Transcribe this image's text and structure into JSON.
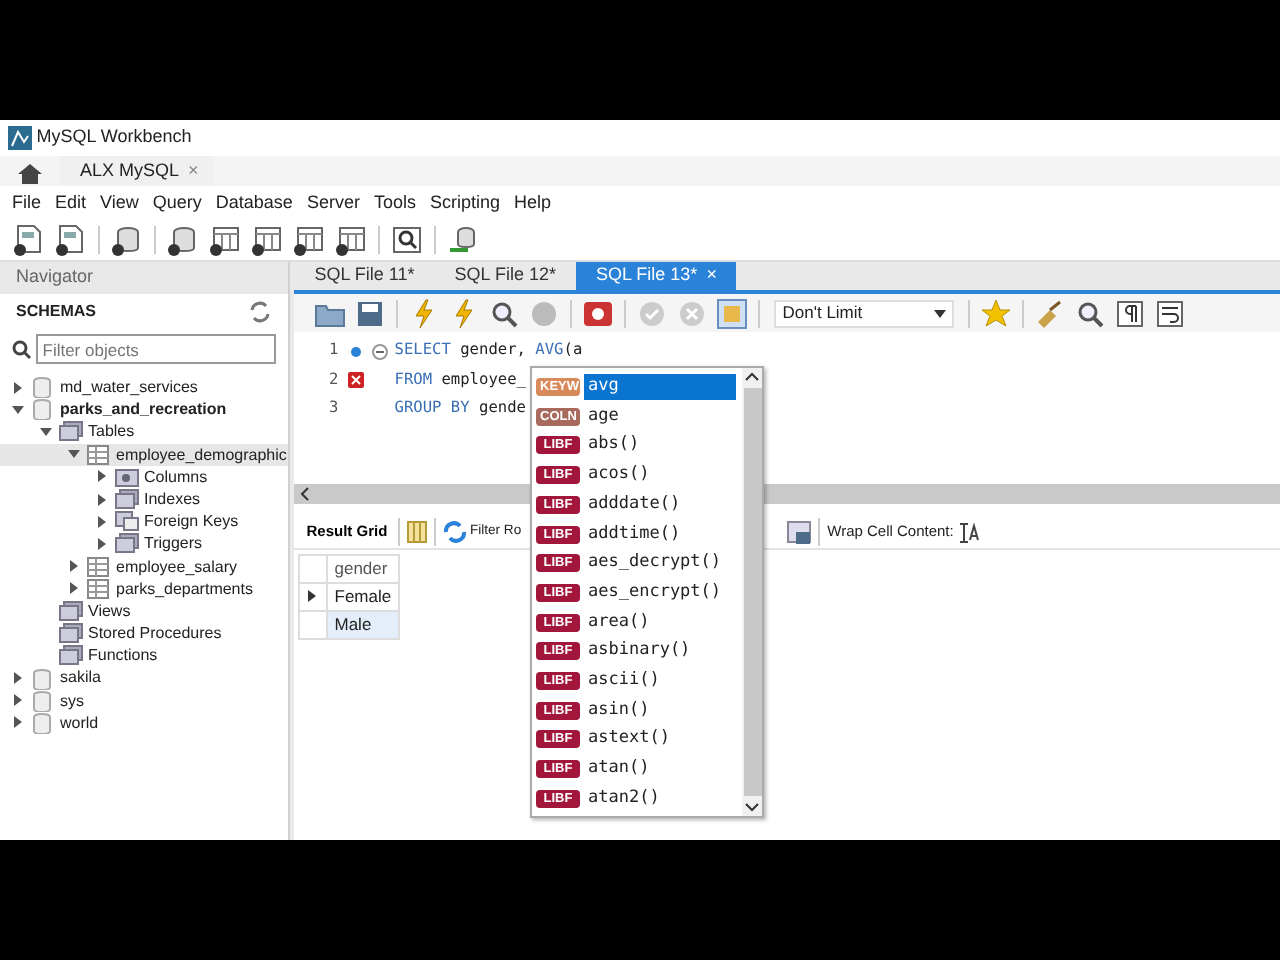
{
  "window": {
    "title": "MySQL Workbench"
  },
  "connection_tabs": [
    {
      "label": "ALX MySQL",
      "close": "×"
    }
  ],
  "menu": [
    "File",
    "Edit",
    "View",
    "Query",
    "Database",
    "Server",
    "Tools",
    "Scripting",
    "Help"
  ],
  "navigator": {
    "title": "Navigator",
    "section": "SCHEMAS",
    "filter": {
      "placeholder": "Filter objects"
    },
    "tree": [
      {
        "label": "md_water_services",
        "kind": "schema",
        "expanded": false,
        "default": false,
        "selected": false
      },
      {
        "label": "parks_and_recreation",
        "kind": "schema",
        "expanded": true,
        "default": true,
        "selected": false,
        "children": [
          {
            "label": "Tables",
            "kind": "folder",
            "expanded": true,
            "default": false,
            "selected": false,
            "children": [
              {
                "label": "employee_demographic",
                "kind": "table",
                "expanded": true,
                "default": false,
                "selected": true,
                "children": [
                  {
                    "label": "Columns",
                    "kind": "columns",
                    "expanded": false,
                    "default": false,
                    "selected": false
                  },
                  {
                    "label": "Indexes",
                    "kind": "folder",
                    "expanded": false,
                    "default": false,
                    "selected": false
                  },
                  {
                    "label": "Foreign Keys",
                    "kind": "keys",
                    "expanded": false,
                    "default": false,
                    "selected": false
                  },
                  {
                    "label": "Triggers",
                    "kind": "folder",
                    "expanded": false,
                    "default": false,
                    "selected": false
                  }
                ]
              },
              {
                "label": "employee_salary",
                "kind": "table",
                "expanded": false,
                "default": false,
                "selected": false
              },
              {
                "label": "parks_departments",
                "kind": "table",
                "expanded": false,
                "default": false,
                "selected": false
              }
            ]
          },
          {
            "label": "Views",
            "kind": "folder",
            "default": false,
            "selected": false
          },
          {
            "label": "Stored Procedures",
            "kind": "folder",
            "default": false,
            "selected": false
          },
          {
            "label": "Functions",
            "kind": "folder",
            "default": false,
            "selected": false
          }
        ]
      },
      {
        "label": "sakila",
        "kind": "schema",
        "expanded": false,
        "default": false,
        "selected": false
      },
      {
        "label": "sys",
        "kind": "schema",
        "expanded": false,
        "default": false,
        "selected": false
      },
      {
        "label": "world",
        "kind": "schema",
        "expanded": false,
        "default": false,
        "selected": false
      }
    ]
  },
  "editor_tabs": [
    {
      "label": "SQL File 11*",
      "selected": false
    },
    {
      "label": "SQL File 12*",
      "selected": false
    },
    {
      "label": "SQL File 13*",
      "selected": true,
      "close": "×"
    }
  ],
  "limit": {
    "value": "Don't Limit"
  },
  "code": [
    {
      "number": "1",
      "current": true,
      "error": false,
      "fold": true,
      "tokens": [
        {
          "text": "SELECT",
          "kind": "keyword"
        },
        {
          "text": " gender, ",
          "kind": "plain"
        },
        {
          "text": "AVG",
          "kind": "keyword"
        },
        {
          "text": "(a",
          "kind": "plain"
        }
      ]
    },
    {
      "number": "2",
      "current": false,
      "error": true,
      "fold": false,
      "tokens": [
        {
          "text": "FROM",
          "kind": "keyword"
        },
        {
          "text": " employee_",
          "kind": "plain"
        }
      ]
    },
    {
      "number": "3",
      "current": false,
      "error": false,
      "fold": false,
      "tokens": [
        {
          "text": "GROUP BY",
          "kind": "keyword"
        },
        {
          "text": " gende",
          "kind": "plain"
        }
      ]
    }
  ],
  "results": {
    "tab": "Result Grid",
    "filter_label": "Filter Ro",
    "wrap_label": "Wrap Cell Content:",
    "columns": [
      "gender"
    ],
    "rows": [
      {
        "cells": [
          "Female"
        ],
        "current": true,
        "selected": false
      },
      {
        "cells": [
          "Male"
        ],
        "current": false,
        "selected": true
      }
    ]
  },
  "autocomplete": {
    "items": [
      {
        "kind": "keyword",
        "tag": "KEYW",
        "text": "avg",
        "selected": true
      },
      {
        "kind": "column",
        "tag": "COLN",
        "text": "age",
        "selected": false
      },
      {
        "kind": "function",
        "tag": "LIBF",
        "text": "abs()",
        "selected": false
      },
      {
        "kind": "function",
        "tag": "LIBF",
        "text": "acos()",
        "selected": false
      },
      {
        "kind": "function",
        "tag": "LIBF",
        "text": "adddate()",
        "selected": false
      },
      {
        "kind": "function",
        "tag": "LIBF",
        "text": "addtime()",
        "selected": false
      },
      {
        "kind": "function",
        "tag": "LIBF",
        "text": "aes_decrypt()",
        "selected": false
      },
      {
        "kind": "function",
        "tag": "LIBF",
        "text": "aes_encrypt()",
        "selected": false
      },
      {
        "kind": "function",
        "tag": "LIBF",
        "text": "area()",
        "selected": false
      },
      {
        "kind": "function",
        "tag": "LIBF",
        "text": "asbinary()",
        "selected": false
      },
      {
        "kind": "function",
        "tag": "LIBF",
        "text": "ascii()",
        "selected": false
      },
      {
        "kind": "function",
        "tag": "LIBF",
        "text": "asin()",
        "selected": false
      },
      {
        "kind": "function",
        "tag": "LIBF",
        "text": "astext()",
        "selected": false
      },
      {
        "kind": "function",
        "tag": "LIBF",
        "text": "atan()",
        "selected": false
      },
      {
        "kind": "function",
        "tag": "LIBF",
        "text": "atan2()",
        "selected": false
      }
    ]
  }
}
